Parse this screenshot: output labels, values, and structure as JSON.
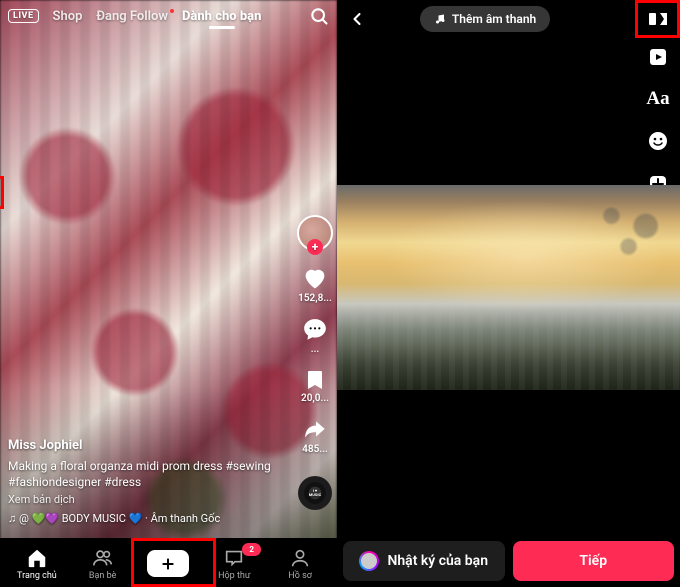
{
  "left": {
    "top": {
      "live": "LIVE",
      "shop": "Shop",
      "following": "Đang Follow",
      "for_you": "Dành cho bạn"
    },
    "rail": {
      "likes": "152,8...",
      "comments": "...",
      "saves": "20,0...",
      "shares": "485..."
    },
    "caption": {
      "user": "Miss Jophiel",
      "text": "Making a floral organza midi prom dress #sewing #fashiondesigner #dress",
      "translate": "Xem bản dịch",
      "sound": "♫ @ 💚💜 BODY MUSIC 💙 · Âm thanh Gốc"
    },
    "nav": {
      "home": "Trang chủ",
      "friends": "Bạn bè",
      "inbox": "Hộp thư",
      "inbox_badge": "2",
      "profile": "Hồ sơ"
    }
  },
  "right": {
    "add_sound": "Thêm âm thanh",
    "text_tool": "Aa",
    "footer": {
      "story": "Nhật ký của bạn",
      "next": "Tiếp"
    }
  }
}
